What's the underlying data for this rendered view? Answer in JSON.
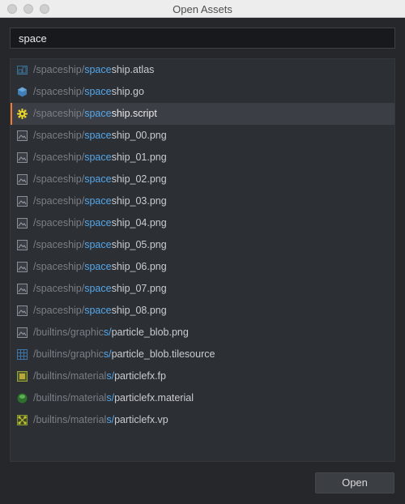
{
  "window": {
    "title": "Open Assets"
  },
  "search": {
    "value": "space"
  },
  "results": [
    {
      "icon": "atlas-icon",
      "path": "/spaceship/",
      "match": "space",
      "rest": "ship.atlas",
      "selected": false
    },
    {
      "icon": "game-object-icon",
      "path": "/spaceship/",
      "match": "space",
      "rest": "ship.go",
      "selected": false
    },
    {
      "icon": "script-gear-icon",
      "path": "/spaceship/",
      "match": "space",
      "rest": "ship.script",
      "selected": true
    },
    {
      "icon": "image-file-icon",
      "path": "/spaceship/",
      "match": "space",
      "rest": "ship_00.png",
      "selected": false
    },
    {
      "icon": "image-file-icon",
      "path": "/spaceship/",
      "match": "space",
      "rest": "ship_01.png",
      "selected": false
    },
    {
      "icon": "image-file-icon",
      "path": "/spaceship/",
      "match": "space",
      "rest": "ship_02.png",
      "selected": false
    },
    {
      "icon": "image-file-icon",
      "path": "/spaceship/",
      "match": "space",
      "rest": "ship_03.png",
      "selected": false
    },
    {
      "icon": "image-file-icon",
      "path": "/spaceship/",
      "match": "space",
      "rest": "ship_04.png",
      "selected": false
    },
    {
      "icon": "image-file-icon",
      "path": "/spaceship/",
      "match": "space",
      "rest": "ship_05.png",
      "selected": false
    },
    {
      "icon": "image-file-icon",
      "path": "/spaceship/",
      "match": "space",
      "rest": "ship_06.png",
      "selected": false
    },
    {
      "icon": "image-file-icon",
      "path": "/spaceship/",
      "match": "space",
      "rest": "ship_07.png",
      "selected": false
    },
    {
      "icon": "image-file-icon",
      "path": "/spaceship/",
      "match": "space",
      "rest": "ship_08.png",
      "selected": false
    },
    {
      "icon": "image-file-icon",
      "path": "/builtins/graphic",
      "match": "s/",
      "rest": "particle_blob.png",
      "selected": false
    },
    {
      "icon": "tilesource-grid-icon",
      "path": "/builtins/graphic",
      "match": "s/",
      "rest": "particle_blob.tilesource",
      "selected": false
    },
    {
      "icon": "fragment-program-icon",
      "path": "/builtins/material",
      "match": "s/",
      "rest": "particlefx.fp",
      "selected": false
    },
    {
      "icon": "material-sphere-icon",
      "path": "/builtins/material",
      "match": "s/",
      "rest": "particlefx.material",
      "selected": false
    },
    {
      "icon": "vertex-program-icon",
      "path": "/builtins/material",
      "match": "s/",
      "rest": "particlefx.vp",
      "selected": false
    }
  ],
  "footer": {
    "open_label": "Open"
  }
}
